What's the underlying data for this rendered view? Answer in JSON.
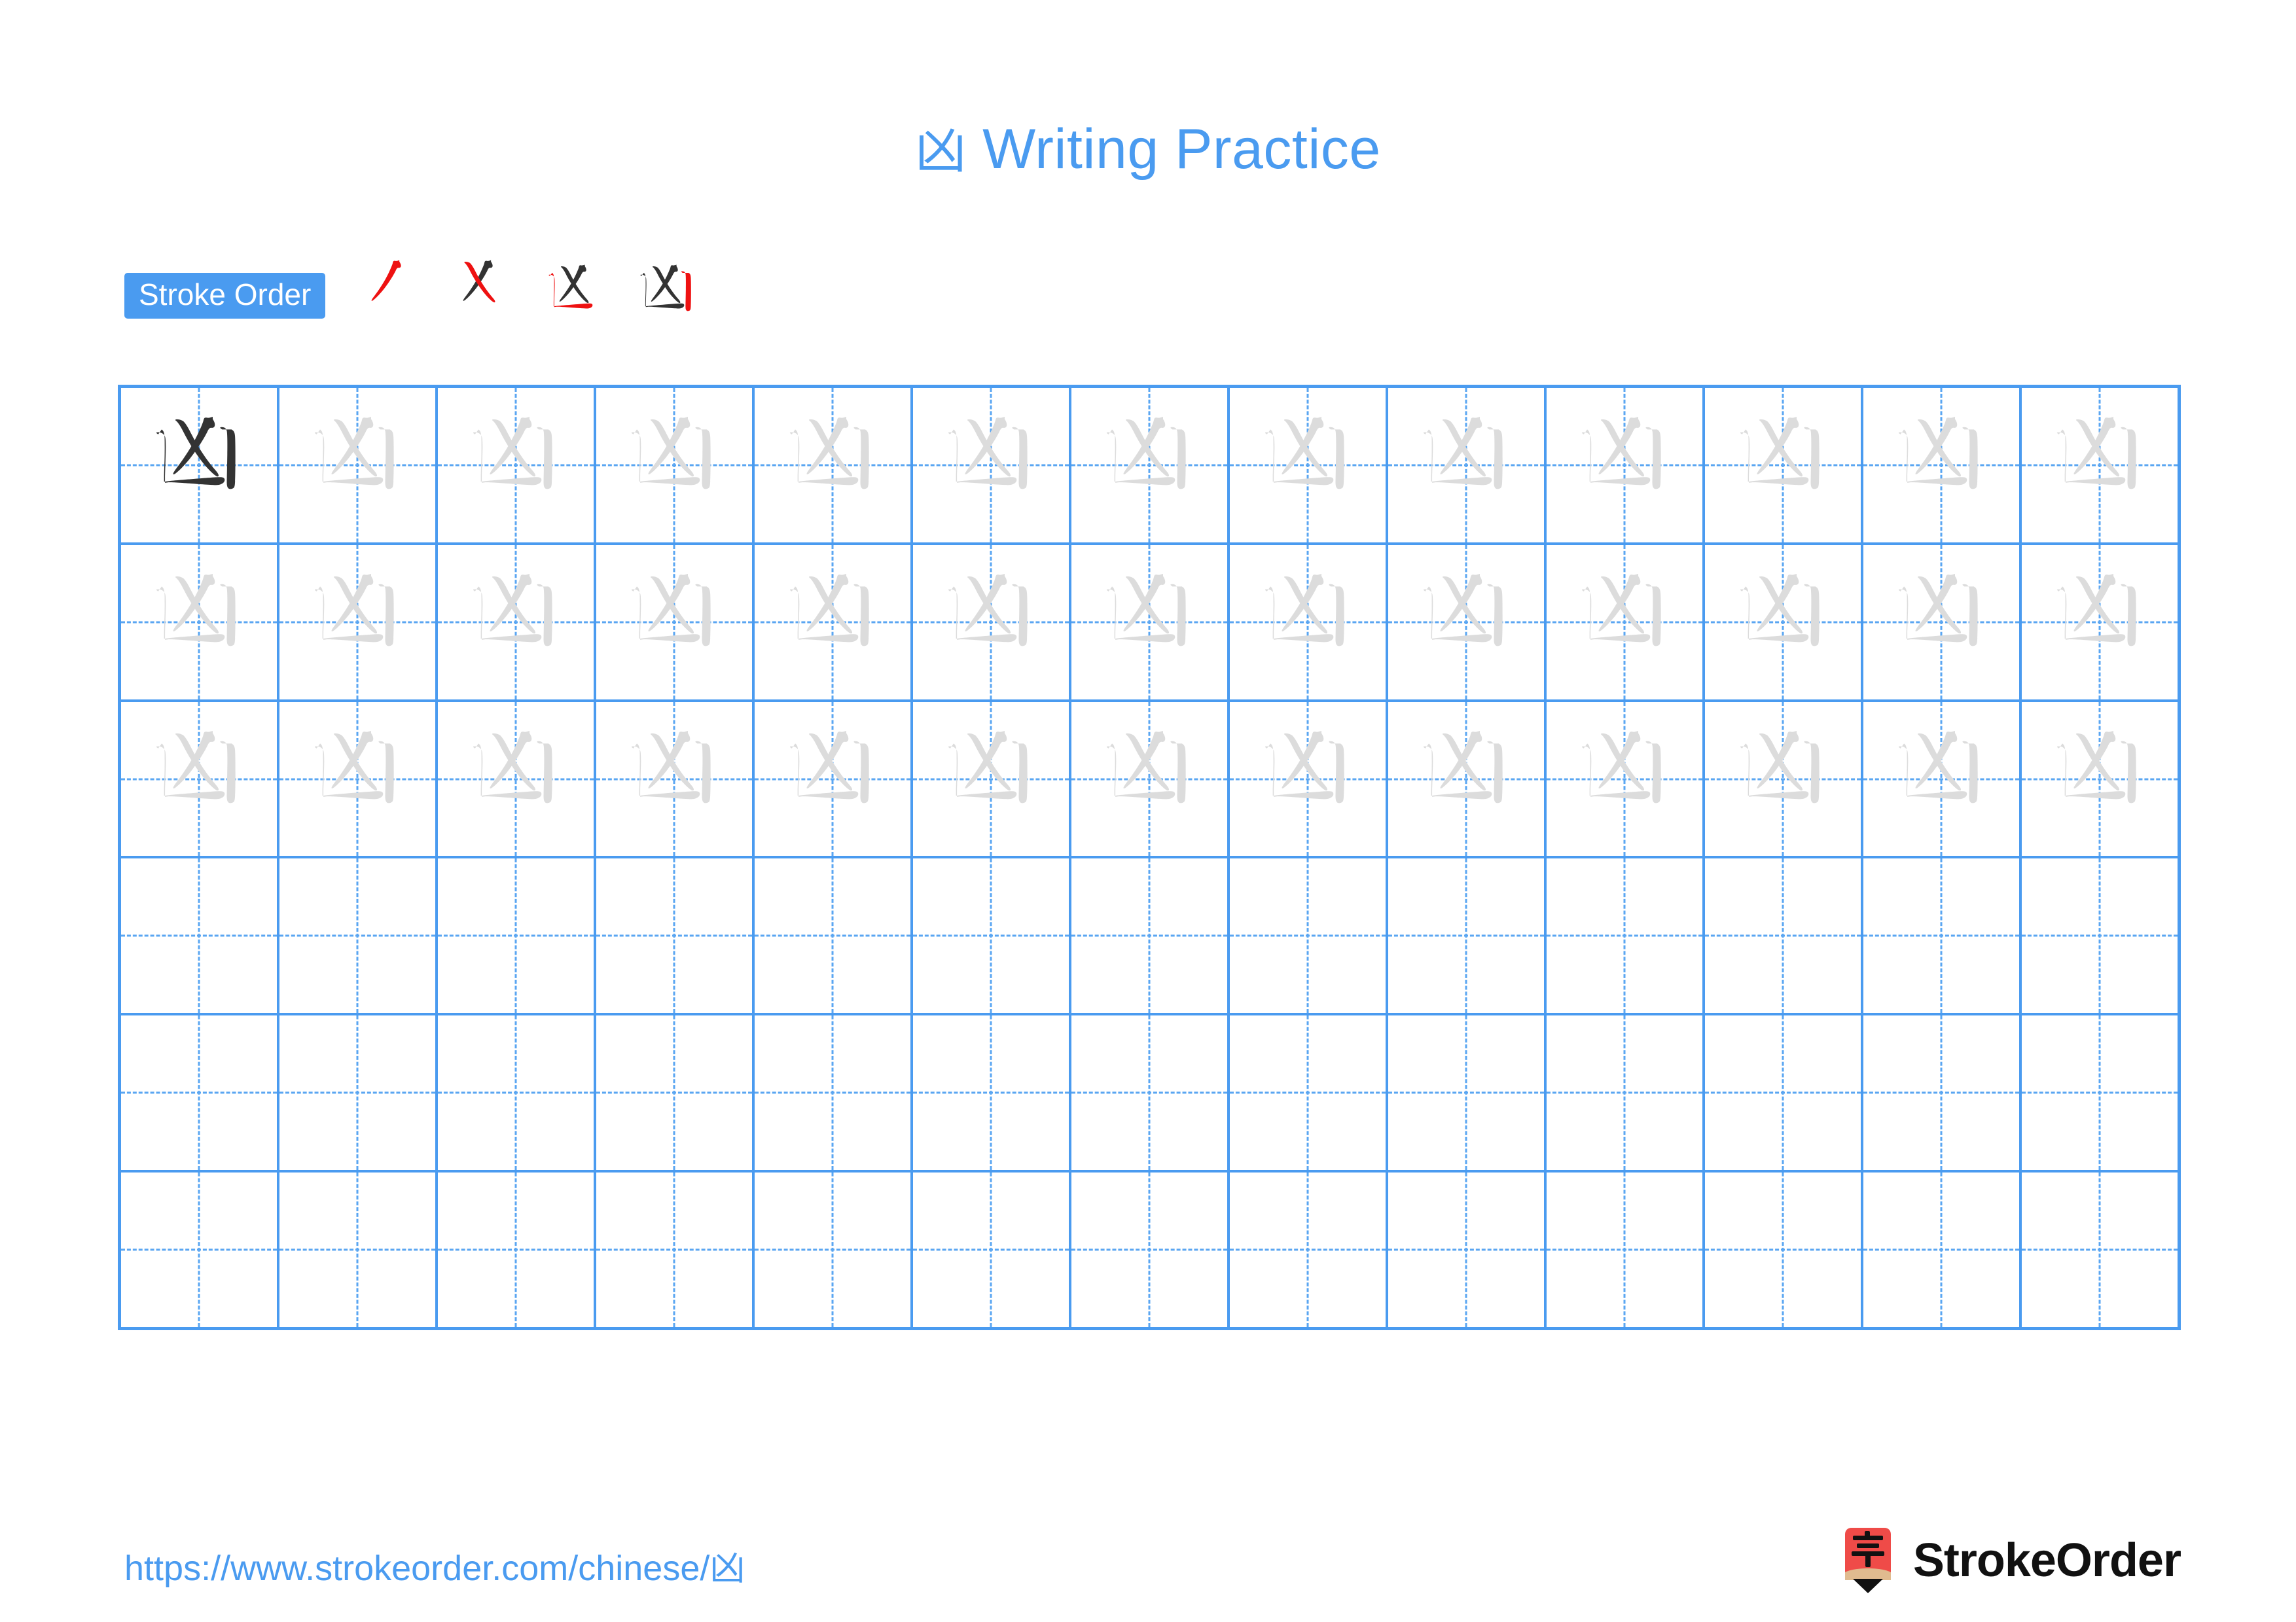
{
  "document": {
    "character": "凶",
    "title_suffix": " Writing Practice",
    "title_full": "凶 Writing Practice"
  },
  "stroke_order": {
    "label": "Stroke Order",
    "stroke_count": 4,
    "steps": [
      {
        "index": 1,
        "new_stroke_name": "pie",
        "new_stroke_color": "#ee1111",
        "previous_color": "#333333"
      },
      {
        "index": 2,
        "new_stroke_name": "na",
        "new_stroke_color": "#ee1111",
        "previous_color": "#333333"
      },
      {
        "index": 3,
        "new_stroke_name": "shu-zhe",
        "new_stroke_color": "#ee1111",
        "previous_color": "#333333"
      },
      {
        "index": 4,
        "new_stroke_name": "shu",
        "new_stroke_color": "#ee1111",
        "previous_color": "#333333"
      }
    ]
  },
  "grid": {
    "columns": 13,
    "rows": 6,
    "border_color": "#4a9bf0",
    "guide_color": "#5aa6f2",
    "traced_dark_color": "#333333",
    "traced_light_color": "#dcdcdc",
    "rows_data": [
      {
        "row": 1,
        "cells": [
          "dark",
          "light",
          "light",
          "light",
          "light",
          "light",
          "light",
          "light",
          "light",
          "light",
          "light",
          "light",
          "light"
        ]
      },
      {
        "row": 2,
        "cells": [
          "light",
          "light",
          "light",
          "light",
          "light",
          "light",
          "light",
          "light",
          "light",
          "light",
          "light",
          "light",
          "light"
        ]
      },
      {
        "row": 3,
        "cells": [
          "light",
          "light",
          "light",
          "light",
          "light",
          "light",
          "light",
          "light",
          "light",
          "light",
          "light",
          "light",
          "light"
        ]
      },
      {
        "row": 4,
        "cells": [
          "empty",
          "empty",
          "empty",
          "empty",
          "empty",
          "empty",
          "empty",
          "empty",
          "empty",
          "empty",
          "empty",
          "empty",
          "empty"
        ]
      },
      {
        "row": 5,
        "cells": [
          "empty",
          "empty",
          "empty",
          "empty",
          "empty",
          "empty",
          "empty",
          "empty",
          "empty",
          "empty",
          "empty",
          "empty",
          "empty"
        ]
      },
      {
        "row": 6,
        "cells": [
          "empty",
          "empty",
          "empty",
          "empty",
          "empty",
          "empty",
          "empty",
          "empty",
          "empty",
          "empty",
          "empty",
          "empty",
          "empty"
        ]
      }
    ]
  },
  "footer": {
    "url": "https://www.strokeorder.com/chinese/凶",
    "brand_name": "StrokeOrder",
    "logo": {
      "icon_character": "字",
      "badge_color": "#ef4b48",
      "pencil_body_color": "#e0bb8f",
      "pencil_tip_color": "#111111"
    }
  },
  "colors": {
    "accent_blue": "#4a9bf0",
    "stroke_red": "#ee1111",
    "ink_dark": "#333333",
    "ink_light": "#dcdcdc",
    "background": "#ffffff"
  }
}
